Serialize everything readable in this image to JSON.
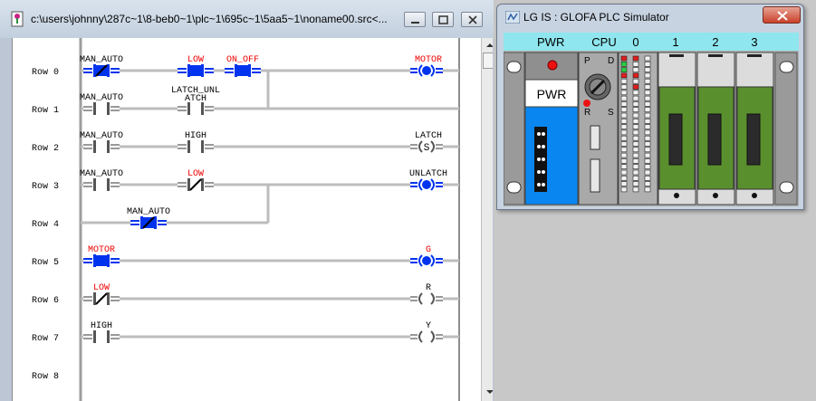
{
  "editor": {
    "title": "c:\\users\\johnny\\287c~1\\8-beb0~1\\plc~1\\695c~1\\5aa5~1\\noname00.src<...",
    "rows": [
      {
        "label": "Row 0"
      },
      {
        "label": "Row 1"
      },
      {
        "label": "Row 2"
      },
      {
        "label": "Row 3"
      },
      {
        "label": "Row 4"
      },
      {
        "label": "Row 5"
      },
      {
        "label": "Row 6"
      },
      {
        "label": "Row 7"
      },
      {
        "label": "Row 8"
      }
    ],
    "contacts": [
      {
        "name": "MAN_AUTO",
        "row": 0,
        "col": 0,
        "kind": "nc",
        "active": true,
        "color": "black"
      },
      {
        "name": "LOW",
        "row": 0,
        "col": 4,
        "kind": "no",
        "active": true,
        "color": "red"
      },
      {
        "name": "ON_OFF",
        "row": 0,
        "col": 6,
        "kind": "no",
        "active": true,
        "color": "red"
      },
      {
        "name": "MAN_AUTO",
        "row": 1,
        "col": 0,
        "kind": "no",
        "active": false,
        "color": "black"
      },
      {
        "name": "LATCH_UNLATCH",
        "row": 1,
        "col": 4,
        "kind": "no",
        "active": false,
        "color": "black"
      },
      {
        "name": "MAN_AUTO",
        "row": 2,
        "col": 0,
        "kind": "no",
        "active": false,
        "color": "black"
      },
      {
        "name": "HIGH",
        "row": 2,
        "col": 4,
        "kind": "no",
        "active": false,
        "color": "black"
      },
      {
        "name": "MAN_AUTO",
        "row": 3,
        "col": 0,
        "kind": "no",
        "active": false,
        "color": "black"
      },
      {
        "name": "LOW",
        "row": 3,
        "col": 4,
        "kind": "nc",
        "active": false,
        "color": "red"
      },
      {
        "name": "MAN_AUTO",
        "row": 4,
        "col": 2,
        "kind": "nc",
        "active": true,
        "color": "black"
      },
      {
        "name": "MOTOR",
        "row": 5,
        "col": 0,
        "kind": "no",
        "active": true,
        "color": "red"
      },
      {
        "name": "LOW",
        "row": 6,
        "col": 0,
        "kind": "nc",
        "active": false,
        "color": "red"
      },
      {
        "name": "HIGH",
        "row": 7,
        "col": 0,
        "kind": "no",
        "active": false,
        "color": "black"
      }
    ],
    "contact_label_overrides": {
      "LATCH_UNLATCH": [
        "LATCH_UNL",
        "ATCH"
      ]
    },
    "coils": [
      {
        "name": "MOTOR",
        "row": 0,
        "kind": "coil",
        "active": true,
        "color": "red"
      },
      {
        "name": "LATCH",
        "row": 2,
        "kind": "set",
        "active": false,
        "color": "black",
        "glyph": "S"
      },
      {
        "name": "UNLATCH",
        "row": 3,
        "kind": "reset",
        "active": true,
        "color": "black"
      },
      {
        "name": "G",
        "row": 5,
        "kind": "coil",
        "active": true,
        "color": "red"
      },
      {
        "name": "R",
        "row": 6,
        "kind": "coil",
        "active": false,
        "color": "black"
      },
      {
        "name": "Y",
        "row": 7,
        "kind": "coil",
        "active": false,
        "color": "black"
      }
    ],
    "colors": {
      "active": "#0033ee",
      "wire": "#bdbdbd",
      "label": "#000000",
      "red_label": "#ee0000"
    }
  },
  "simulator": {
    "title": "LG IS : GLOFA PLC Simulator",
    "slots": [
      "PWR",
      "CPU",
      "0",
      "1",
      "2",
      "3"
    ],
    "power_module_label": "PWR",
    "cpu_mode_labels": {
      "p": "P",
      "d": "D",
      "r": "R",
      "s": "S"
    },
    "colors": {
      "header": "#8fe6ee",
      "power_blue": "#0a86f0",
      "io_green": "#5a8f2e"
    }
  }
}
